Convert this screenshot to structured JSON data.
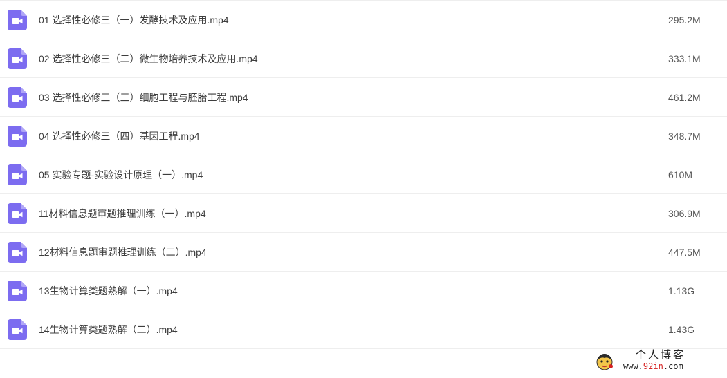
{
  "files": [
    {
      "name": "01 选择性必修三（一）发酵技术及应用.mp4",
      "size": "295.2M",
      "icon": "video-file-icon"
    },
    {
      "name": "02 选择性必修三（二）微生物培养技术及应用.mp4",
      "size": "333.1M",
      "icon": "video-file-icon"
    },
    {
      "name": "03 选择性必修三（三）细胞工程与胚胎工程.mp4",
      "size": "461.2M",
      "icon": "video-file-icon"
    },
    {
      "name": "04 选择性必修三（四）基因工程.mp4",
      "size": "348.7M",
      "icon": "video-file-icon"
    },
    {
      "name": "05 实验专题-实验设计原理（一）.mp4",
      "size": "610M",
      "icon": "video-file-icon"
    },
    {
      "name": "11材料信息题审题推理训练（一）.mp4",
      "size": "306.9M",
      "icon": "video-file-icon"
    },
    {
      "name": "12材料信息题审题推理训练（二）.mp4",
      "size": "447.5M",
      "icon": "video-file-icon"
    },
    {
      "name": "13生物计算类题熟解（一）.mp4",
      "size": "1.13G",
      "icon": "video-file-icon"
    },
    {
      "name": "14生物计算类题熟解（二）.mp4",
      "size": "1.43G",
      "icon": "video-file-icon"
    }
  ],
  "watermark": {
    "title": "个人博客",
    "url_prefix": "www.",
    "url_highlight": "92in",
    "url_suffix": ".com"
  },
  "colors": {
    "icon_purple": "#7c6cf0",
    "row_divider": "#eeeeee",
    "text": "#3d3d3d"
  }
}
